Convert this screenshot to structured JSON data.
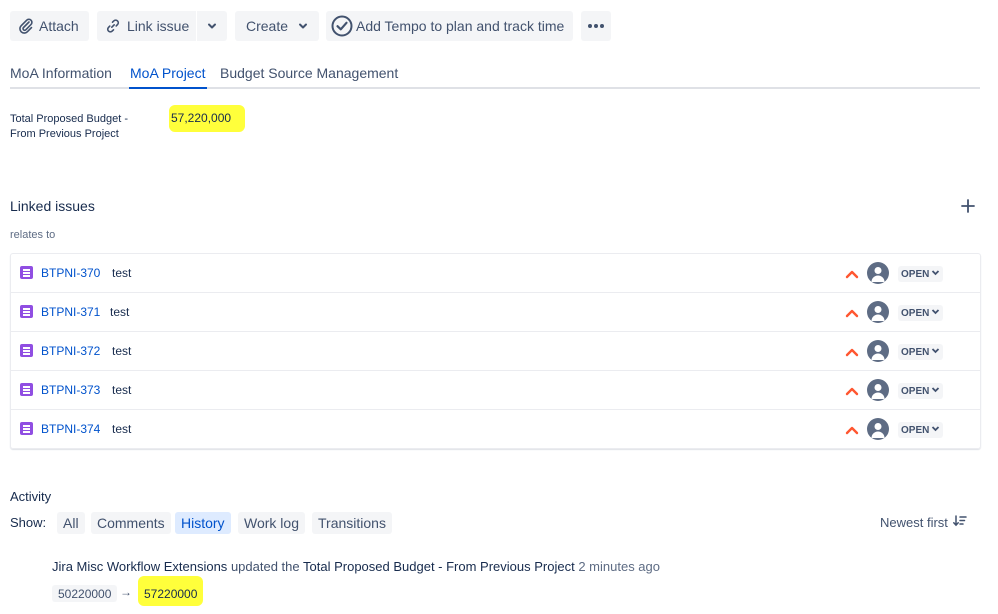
{
  "toolbar": {
    "attach_label": "Attach",
    "link_issue_label": "Link issue",
    "create_label": "Create",
    "tempo_label": "Add Tempo to plan and track time"
  },
  "tabs": [
    {
      "label": "MoA Information",
      "active": false
    },
    {
      "label": "MoA Project",
      "active": true
    },
    {
      "label": "Budget Source Management",
      "active": false
    }
  ],
  "budget_field": {
    "label_line1": "Total Proposed Budget -",
    "label_line2": "From Previous Project",
    "value": "57,220,000"
  },
  "linked_issues": {
    "title": "Linked issues",
    "relation": "relates to",
    "items": [
      {
        "key": "BTPNI-370",
        "summary": "test",
        "status": "OPEN"
      },
      {
        "key": "BTPNI-371",
        "summary": "test",
        "status": "OPEN"
      },
      {
        "key": "BTPNI-372",
        "summary": "test",
        "status": "OPEN"
      },
      {
        "key": "BTPNI-373",
        "summary": "test",
        "status": "OPEN"
      },
      {
        "key": "BTPNI-374",
        "summary": "test",
        "status": "OPEN"
      }
    ]
  },
  "activity": {
    "title": "Activity",
    "show_label": "Show:",
    "filters": [
      {
        "label": "All",
        "active": false
      },
      {
        "label": "Comments",
        "active": false
      },
      {
        "label": "History",
        "active": true
      },
      {
        "label": "Work log",
        "active": false
      },
      {
        "label": "Transitions",
        "active": false
      }
    ],
    "sort_label": "Newest first",
    "history": {
      "actor": "Jira Misc Workflow Extensions",
      "action": "updated the",
      "field": "Total Proposed Budget - From Previous Project",
      "time": "2 minutes ago",
      "old_value": "50220000",
      "arrow": "→",
      "new_value": "57220000"
    }
  },
  "colors": {
    "link": "#0052cc",
    "highlight": "#ffff3b",
    "priority": "#ff5630",
    "story": "#904ee2"
  }
}
